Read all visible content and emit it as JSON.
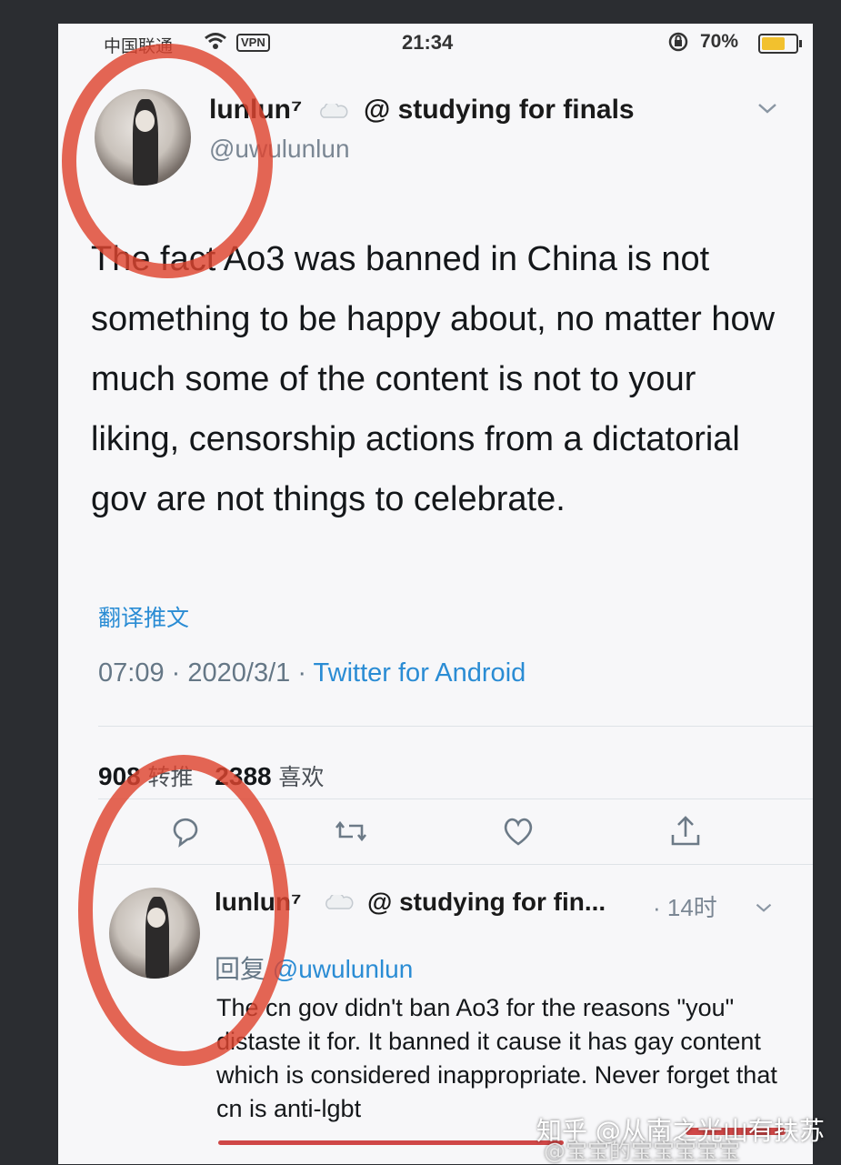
{
  "status_bar": {
    "carrier": "中国联通",
    "vpn_label": "VPN",
    "time": "21:34",
    "battery": "70%",
    "battery_level": 0.7
  },
  "tweet": {
    "display_name": "lunlun⁷",
    "status": "@ studying for finals",
    "handle": "@uwulunlun",
    "text": "The fact Ao3 was banned in China is not something to be happy about, no matter how much some of the content is not to your liking, censorship actions from a dictatorial gov are not things to celebrate.",
    "translate_label": "翻译推文",
    "time": "07:09",
    "date": "2020/3/1",
    "separator": "·",
    "source": "Twitter for Android",
    "retweets_count": "908",
    "retweets_label": "转推",
    "likes_count": "2388",
    "likes_label": "喜欢"
  },
  "reply": {
    "display_name": "lunlun⁷",
    "status": "@ studying for fin...",
    "time_ago": "· 14时",
    "reply_label": "回复",
    "reply_to": "@uwulunlun",
    "text": "The cn gov didn't ban Ao3 for the reasons \"you\" distaste it for. It banned it cause it has gay content which is considered inappropriate. Never forget that cn is anti-lgbt"
  },
  "watermark": {
    "zhihu": "知乎 @从南之光山有扶苏",
    "weibo": "@宝宝的宝宝宝宝宝"
  },
  "colors": {
    "link": "#2a8cd4",
    "annotation_red": "#de4430",
    "battery": "#f2c12e"
  },
  "icons": [
    "wifi-icon",
    "lock-rotation-icon",
    "cloud-icon",
    "chevron-down-icon",
    "reply-icon",
    "retweet-icon",
    "like-icon",
    "share-icon"
  ]
}
